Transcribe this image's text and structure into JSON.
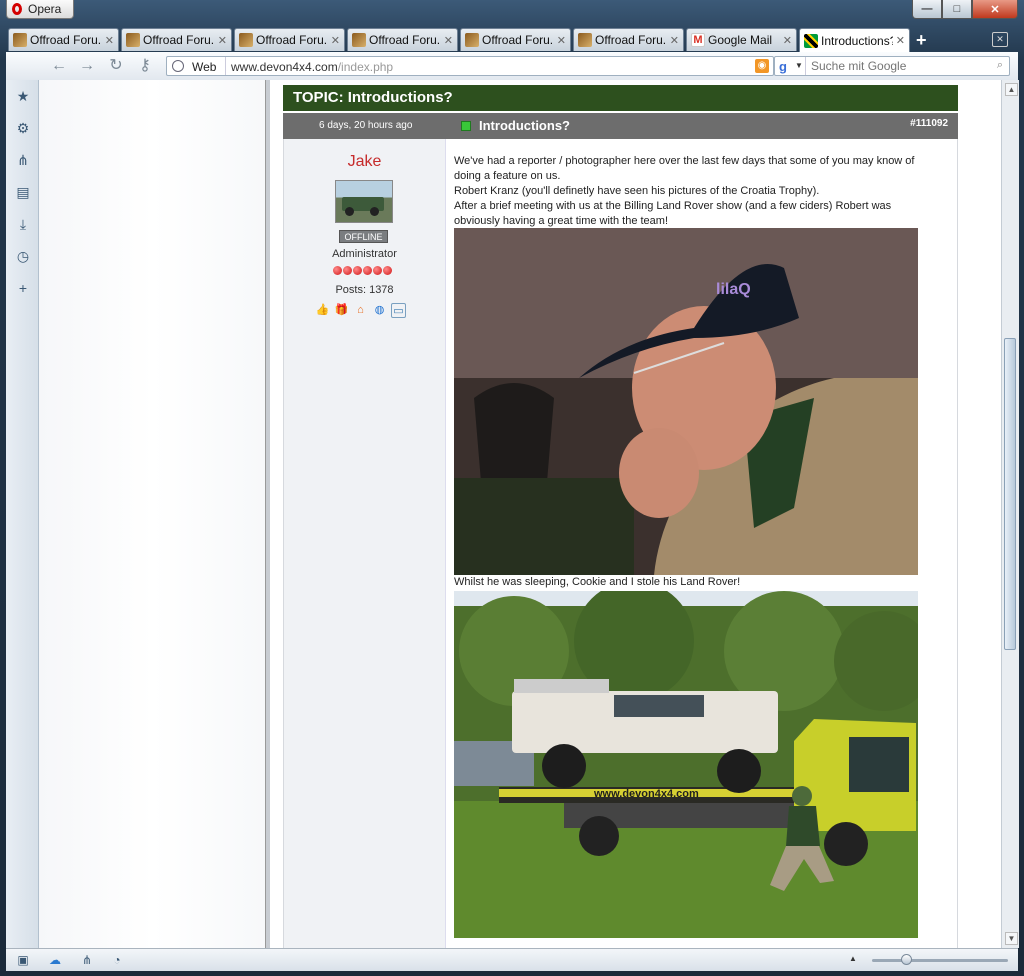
{
  "window": {
    "app_button_label": "Opera",
    "controls": {
      "minimize": "—",
      "maximize": "□",
      "close": "✕"
    }
  },
  "tabs": [
    {
      "label": "Offroad Foru...",
      "favicon": "forum-favicon",
      "active": false
    },
    {
      "label": "Offroad Foru...",
      "favicon": "forum-favicon",
      "active": false
    },
    {
      "label": "Offroad Foru...",
      "favicon": "forum-favicon",
      "active": false
    },
    {
      "label": "Offroad Foru...",
      "favicon": "forum-favicon",
      "active": false
    },
    {
      "label": "Offroad Foru...",
      "favicon": "forum-favicon",
      "active": false
    },
    {
      "label": "Offroad Foru...",
      "favicon": "forum-favicon",
      "active": false
    },
    {
      "label": "Google Mail",
      "favicon": "gmail-favicon",
      "active": false
    },
    {
      "label": "Introductions?",
      "favicon": "jamaica-flag-favicon",
      "active": true
    }
  ],
  "address_bar": {
    "security_label": "Web",
    "url_host": "www.devon4x4.com",
    "url_path": "/index.php"
  },
  "search": {
    "engine_glyph": "g",
    "placeholder": "Suche mit Google"
  },
  "topic": {
    "title": "TOPIC: Introductions?"
  },
  "post": {
    "date": "6 days, 20 hours ago",
    "title": "Introductions?",
    "number": "#111092",
    "author": {
      "name": "Jake",
      "status": "OFFLINE",
      "role": "Administrator",
      "rank_dots": 6,
      "posts": "Posts: 1378"
    },
    "message_lines": [
      "We've had a reporter / photographer here over the last few days that some of you may know of doing a feature on us.",
      "Robert Kranz (you'll definetly have seen his pictures of the Croatia Trophy).",
      "After a brief meeting with us at the Billing Land Rover show (and a few ciders) Robert was obviously having a great time with the team!"
    ],
    "photo_caption": "Whilst he was sleeping, Cookie and I stole his Land Rover!",
    "photo1_cap_text": "lilaQ",
    "photo2_banner_text": "www.devon4x4.com"
  },
  "colors": {
    "topic_bar": "#2d501e",
    "post_header": "#6d6d6d",
    "author_name": "#c62b2b",
    "online_indicator": "#39c739"
  },
  "zoom": {
    "level": 0.25
  }
}
